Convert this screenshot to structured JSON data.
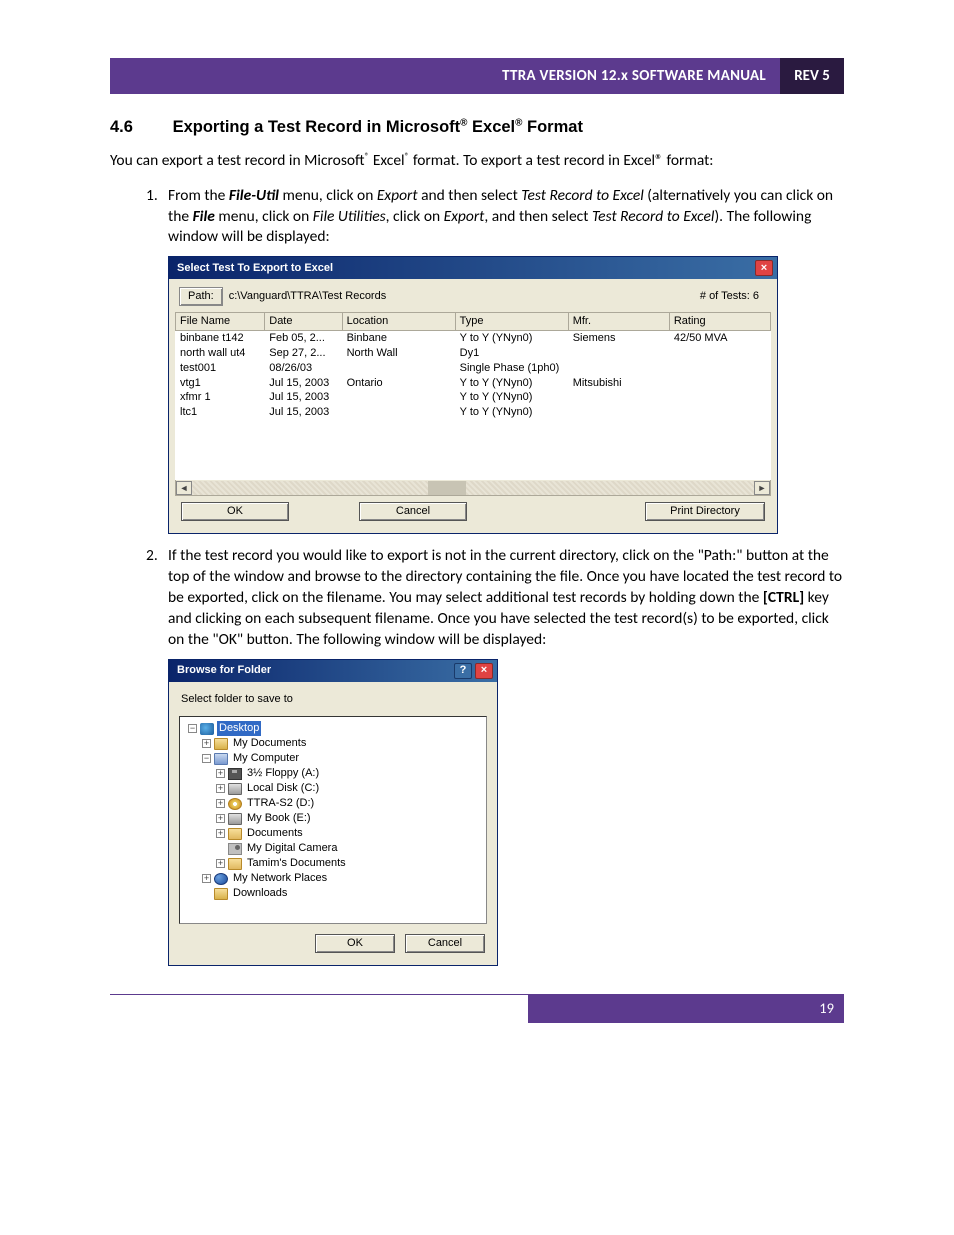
{
  "header": {
    "title": "TTRA VERSION 12.x SOFTWARE MANUAL",
    "rev": "REV 5"
  },
  "section": {
    "number": "4.6",
    "title_a": "Exporting a Test Record in Microsoft",
    "title_b": " Excel",
    "title_c": " Format"
  },
  "intro_a": "You can export a test record in Microsoft",
  "intro_b": " Excel",
  "intro_c": " format. To export a test record in Excel® format:",
  "step1": {
    "a": "From the ",
    "fileutil": "File-Util",
    "b": " menu, click on ",
    "export": "Export",
    "c": " and then select ",
    "tre": "Test Record to Excel",
    "d": " (alternatively you can click on the ",
    "file": "File",
    "e": " menu, click on ",
    "futil": "File Utilities",
    "f": ", click on ",
    "export2": "Export",
    "g": ", and then select ",
    "tre2": "Test Record to Excel",
    "h": "). The following window will be displayed:"
  },
  "dlg1": {
    "title": "Select Test To Export to Excel",
    "path_btn": "Path:",
    "path_value": "c:\\Vanguard\\TTRA\\Test Records",
    "tests_label": "# of Tests: 6",
    "cols": [
      "File Name",
      "Date",
      "Location",
      "Type",
      "Mfr.",
      "Rating"
    ],
    "widths": [
      "15%",
      "13%",
      "19%",
      "19%",
      "17%",
      "17%"
    ],
    "rows": [
      [
        "binbane t142",
        "Feb 05, 2...",
        "Binbane",
        "Y to Y (YNyn0)",
        "Siemens",
        "42/50 MVA"
      ],
      [
        "north wall ut4",
        "Sep 27, 2...",
        "North Wall",
        "Dy1",
        "",
        ""
      ],
      [
        "test001",
        "08/26/03",
        "",
        "Single Phase (1ph0)",
        "",
        ""
      ],
      [
        "vtg1",
        "Jul 15, 2003",
        "Ontario",
        "Y to Y (YNyn0)",
        "Mitsubishi",
        ""
      ],
      [
        "xfmr 1",
        "Jul 15, 2003",
        "",
        "Y to Y (YNyn0)",
        "",
        ""
      ],
      [
        "ltc1",
        "Jul 15, 2003",
        "",
        "Y to Y (YNyn0)",
        "",
        ""
      ]
    ],
    "ok": "OK",
    "cancel": "Cancel",
    "print": "Print Directory"
  },
  "step2": {
    "text_a": "If the test record you would like to export is not in the current directory, click on the \"Path:\" button at the top of the window and browse to the directory containing the file. Once you have located the test record to be exported, click on the filename. You may select additional test records by holding down the ",
    "ctrl": "[CTRL]",
    "text_b": " key and clicking on each subsequent filename. Once you have selected the test record(s) to be exported, click on the \"OK\" button. The following window will be displayed:"
  },
  "dlg2": {
    "title": "Browse for Folder",
    "prompt": "Select folder to save to",
    "tree": [
      {
        "indent": 0,
        "twisty": "−",
        "icon": "ic-desktop",
        "label": "Desktop",
        "sel": true
      },
      {
        "indent": 1,
        "twisty": "+",
        "icon": "ic-folder",
        "label": "My Documents"
      },
      {
        "indent": 1,
        "twisty": "−",
        "icon": "ic-computer",
        "label": "My Computer"
      },
      {
        "indent": 2,
        "twisty": "+",
        "icon": "ic-floppy",
        "label": "3½ Floppy (A:)"
      },
      {
        "indent": 2,
        "twisty": "+",
        "icon": "ic-disk",
        "label": "Local Disk (C:)"
      },
      {
        "indent": 2,
        "twisty": "+",
        "icon": "ic-cd",
        "label": "TTRA-S2 (D:)"
      },
      {
        "indent": 2,
        "twisty": "+",
        "icon": "ic-disk",
        "label": "My Book (E:)"
      },
      {
        "indent": 2,
        "twisty": "+",
        "icon": "ic-folder-open",
        "label": "Documents"
      },
      {
        "indent": 2,
        "twisty": "",
        "icon": "ic-cam",
        "label": "My Digital Camera"
      },
      {
        "indent": 2,
        "twisty": "+",
        "icon": "ic-folder-open",
        "label": "Tamim's Documents"
      },
      {
        "indent": 1,
        "twisty": "+",
        "icon": "ic-net",
        "label": "My Network Places"
      },
      {
        "indent": 1,
        "twisty": "",
        "icon": "ic-folder",
        "label": "Downloads"
      }
    ],
    "ok": "OK",
    "cancel": "Cancel"
  },
  "page_number": "19"
}
